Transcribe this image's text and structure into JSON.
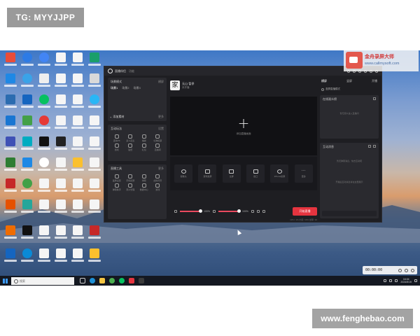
{
  "overlay": {
    "tg_label": "TG: MYYJJPP",
    "site_label": "www.fenghebao.com"
  },
  "watermark": {
    "title": "金舟录屏大师",
    "url": "www.callmysoft.com"
  },
  "app": {
    "title": "直播伴侣",
    "subtitle": "功能",
    "scene_panel": {
      "title": "场景模式",
      "right": "横屏",
      "tabs": [
        "场景1",
        "场景2",
        "场景3"
      ],
      "add_source": "添加素材",
      "add_right": "更多"
    },
    "interact_panel": {
      "title": "互动玩法",
      "right": "设置",
      "items": [
        "连线PK",
        "多人连麦",
        "福袋",
        "礼物投票",
        "游戏",
        "贴纸",
        "红包",
        "直播间"
      ]
    },
    "tools_panel": {
      "title": "直播工具",
      "right": "更多",
      "items": [
        "画质设置",
        "手机投屏",
        "绿幕",
        "虚拟背景",
        "弹幕助手",
        "观众管理",
        "数据中心",
        "游戏"
      ]
    },
    "streamer": {
      "name": "无山·暂停",
      "sub": "未开播",
      "avatar_char": "家"
    },
    "preview": {
      "hint": "添加直播画面"
    },
    "tool_buttons": [
      "摄像头",
      "游戏投屏",
      "全屏",
      "窗口",
      "iPhone投屏",
      "更多"
    ],
    "controls": {
      "mic_percent": "100%",
      "speaker_percent": "100%",
      "mic_level": 1.0,
      "speaker_level": 1.0,
      "go_live": "开始直播"
    },
    "status_line": "CPU: 1%  内存: 60%  帧率: 30",
    "right": {
      "tabs": [
        "横屏",
        "竖屏",
        "开播"
      ],
      "toggle_label": "竖屏直播模式",
      "audience_title": "在线观众榜",
      "audience_empty": "暂无观众进入直播间",
      "chat_title": "互动消息",
      "chat_empty_1": "暂无弹幕消息，快去互动吧",
      "chat_empty_2": "开播后互动消息将在这里展示"
    }
  },
  "recorder": {
    "time": "00:00:00"
  },
  "taskbar": {
    "search_placeholder": "搜索",
    "clock_time": "16:04",
    "clock_date": "2024/5/19"
  },
  "colors": {
    "accent": "#e5343f",
    "app_bg": "#1e1e22",
    "panel_bg": "#2a2a2f",
    "taskbar_bg": "#141821"
  }
}
